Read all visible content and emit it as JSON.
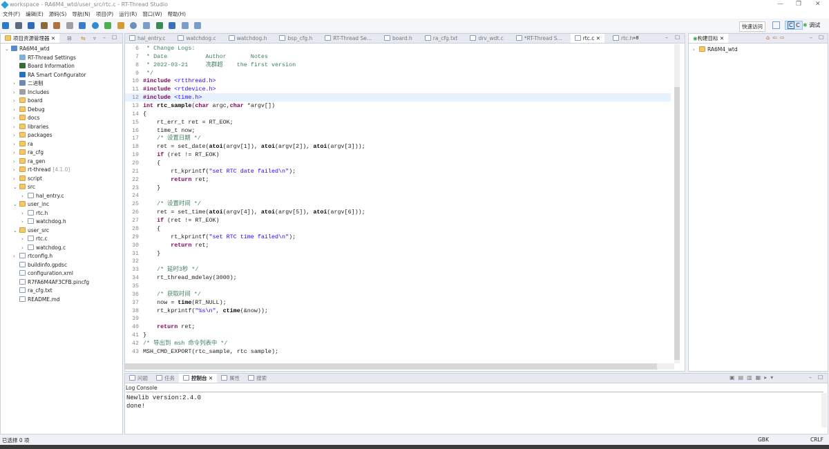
{
  "window": {
    "title": "workspace - RA6M4_wtd/user_src/rtc.c - RT-Thread Studio"
  },
  "menu": [
    "文件(F)",
    "编辑(E)",
    "源码(S)",
    "导航(N)",
    "项目(P)",
    "运行(R)",
    "窗口(W)",
    "帮助(H)"
  ],
  "toolbar": {
    "quick_access": "快速访问",
    "perspective_c": "C",
    "perspective_debug": "调试"
  },
  "explorer": {
    "tab": "项目资源管理器",
    "items": [
      {
        "label": "RA6M4_wtd",
        "level": 0,
        "chev": "v",
        "icon": "project"
      },
      {
        "label": "RT-Thread Settings",
        "level": 1,
        "chev": "",
        "icon": "settings"
      },
      {
        "label": "Board Information",
        "level": 1,
        "chev": "",
        "icon": "board"
      },
      {
        "label": "RA Smart Configurator",
        "level": 1,
        "chev": "",
        "icon": "config"
      },
      {
        "label": "二进制",
        "level": 1,
        "chev": ">",
        "icon": "binary"
      },
      {
        "label": "Includes",
        "level": 1,
        "chev": ">",
        "icon": "includes"
      },
      {
        "label": "board",
        "level": 1,
        "chev": ">",
        "icon": "folder"
      },
      {
        "label": "Debug",
        "level": 1,
        "chev": ">",
        "icon": "folder"
      },
      {
        "label": "docs",
        "level": 1,
        "chev": ">",
        "icon": "folder"
      },
      {
        "label": "libraries",
        "level": 1,
        "chev": ">",
        "icon": "folder"
      },
      {
        "label": "packages",
        "level": 1,
        "chev": ">",
        "icon": "folder"
      },
      {
        "label": "ra",
        "level": 1,
        "chev": ">",
        "icon": "folder"
      },
      {
        "label": "ra_cfg",
        "level": 1,
        "chev": ">",
        "icon": "folder"
      },
      {
        "label": "ra_gen",
        "level": 1,
        "chev": ">",
        "icon": "folder"
      },
      {
        "label": "rt-thread",
        "suffix": "[4.1.0]",
        "level": 1,
        "chev": ">",
        "icon": "folder"
      },
      {
        "label": "script",
        "level": 1,
        "chev": ">",
        "icon": "folder"
      },
      {
        "label": "src",
        "level": 1,
        "chev": "v",
        "icon": "folder"
      },
      {
        "label": "hal_entry.c",
        "level": 2,
        "chev": ">",
        "icon": "file"
      },
      {
        "label": "user_inc",
        "level": 1,
        "chev": "v",
        "icon": "folder"
      },
      {
        "label": "rtc.h",
        "level": 2,
        "chev": ">",
        "icon": "file"
      },
      {
        "label": "watchdog.h",
        "level": 2,
        "chev": ">",
        "icon": "file"
      },
      {
        "label": "user_src",
        "level": 1,
        "chev": "v",
        "icon": "folder"
      },
      {
        "label": "rtc.c",
        "level": 2,
        "chev": ">",
        "icon": "file"
      },
      {
        "label": "watchdog.c",
        "level": 2,
        "chev": ">",
        "icon": "file"
      },
      {
        "label": "rtconfig.h",
        "level": 1,
        "chev": ">",
        "icon": "file"
      },
      {
        "label": "buildinfo.gpdsc",
        "level": 1,
        "chev": "",
        "icon": "file"
      },
      {
        "label": "configuration.xml",
        "level": 1,
        "chev": "",
        "icon": "file"
      },
      {
        "label": "R7FA6M4AF3CFB.pincfg",
        "level": 1,
        "chev": "",
        "icon": "file"
      },
      {
        "label": "ra_cfg.txt",
        "level": 1,
        "chev": "",
        "icon": "file"
      },
      {
        "label": "README.md",
        "level": 1,
        "chev": "",
        "icon": "file"
      }
    ]
  },
  "editor": {
    "tabs": [
      {
        "label": "hal_entry.c"
      },
      {
        "label": "watchdog.c"
      },
      {
        "label": "watchdog.h"
      },
      {
        "label": "bsp_cfg.h"
      },
      {
        "label": "RT-Thread Se..."
      },
      {
        "label": "board.h"
      },
      {
        "label": "ra_cfg.txt"
      },
      {
        "label": "drv_wdt.c"
      },
      {
        "label": "*RT-Thread S..."
      },
      {
        "label": "rtc.c",
        "active": true
      },
      {
        "label": "rtc.h"
      }
    ],
    "overflow": "»8",
    "highlight_line": 12,
    "lines": [
      {
        "n": "6",
        "t": [
          [
            "cm",
            " * Change Logs:"
          ]
        ]
      },
      {
        "n": "7",
        "t": [
          [
            "cm",
            " * Date           Author       Notes"
          ]
        ]
      },
      {
        "n": "8",
        "t": [
          [
            "cm",
            " * 2022-03-21     冼群超    the first version"
          ]
        ]
      },
      {
        "n": "9",
        "t": [
          [
            "cm",
            " */"
          ]
        ]
      },
      {
        "n": "10",
        "t": [
          [
            "pp",
            "#include"
          ],
          [
            "st",
            " <rtthread.h>"
          ]
        ]
      },
      {
        "n": "11",
        "t": [
          [
            "pp",
            "#include"
          ],
          [
            "st",
            " <rtdevice.h>"
          ]
        ]
      },
      {
        "n": "12",
        "t": [
          [
            "pp",
            "#include"
          ],
          [
            "st",
            " <time.h>"
          ]
        ]
      },
      {
        "n": "13",
        "t": [
          [
            "kw",
            "int"
          ],
          [
            "fn",
            " rtc_sample"
          ],
          [
            "",
            "("
          ],
          [
            "kw",
            "char"
          ],
          [
            "",
            " argc,"
          ],
          [
            "kw",
            "char"
          ],
          [
            "",
            " *argv[])"
          ]
        ]
      },
      {
        "n": "14",
        "t": [
          [
            "",
            "{"
          ]
        ]
      },
      {
        "n": "15",
        "t": [
          [
            "",
            "    rt_err_t ret = RT_EOK;"
          ]
        ]
      },
      {
        "n": "16",
        "t": [
          [
            "",
            "    time_t now;"
          ]
        ]
      },
      {
        "n": "17",
        "t": [
          [
            "cm",
            "    /* 设置日期 */"
          ]
        ]
      },
      {
        "n": "18",
        "t": [
          [
            "",
            "    ret = set_date("
          ],
          [
            "fn",
            "atoi"
          ],
          [
            "",
            "(argv[1]), "
          ],
          [
            "fn",
            "atoi"
          ],
          [
            "",
            "(argv[2]), "
          ],
          [
            "fn",
            "atoi"
          ],
          [
            "",
            "(argv[3]));"
          ]
        ]
      },
      {
        "n": "19",
        "t": [
          [
            "kw",
            "    if"
          ],
          [
            "",
            " (ret != RT_EOK)"
          ]
        ]
      },
      {
        "n": "20",
        "t": [
          [
            "",
            "    {"
          ]
        ]
      },
      {
        "n": "21",
        "t": [
          [
            "",
            "        rt_kprintf("
          ],
          [
            "st",
            "\"set RTC date failed\\n\""
          ],
          [
            "",
            ");"
          ]
        ]
      },
      {
        "n": "22",
        "t": [
          [
            "kw",
            "        return"
          ],
          [
            "",
            " ret;"
          ]
        ]
      },
      {
        "n": "23",
        "t": [
          [
            "",
            "    }"
          ]
        ]
      },
      {
        "n": "24",
        "t": [
          [
            "",
            ""
          ]
        ]
      },
      {
        "n": "25",
        "t": [
          [
            "cm",
            "    /* 设置时间 */"
          ]
        ]
      },
      {
        "n": "26",
        "t": [
          [
            "",
            "    ret = set_time("
          ],
          [
            "fn",
            "atoi"
          ],
          [
            "",
            "(argv[4]), "
          ],
          [
            "fn",
            "atoi"
          ],
          [
            "",
            "(argv[5]), "
          ],
          [
            "fn",
            "atoi"
          ],
          [
            "",
            "(argv[6]));"
          ]
        ]
      },
      {
        "n": "27",
        "t": [
          [
            "kw",
            "    if"
          ],
          [
            "",
            " (ret != RT_EOK)"
          ]
        ]
      },
      {
        "n": "28",
        "t": [
          [
            "",
            "    {"
          ]
        ]
      },
      {
        "n": "29",
        "t": [
          [
            "",
            "        rt_kprintf("
          ],
          [
            "st",
            "\"set RTC time failed\\n\""
          ],
          [
            "",
            ");"
          ]
        ]
      },
      {
        "n": "30",
        "t": [
          [
            "kw",
            "        return"
          ],
          [
            "",
            " ret;"
          ]
        ]
      },
      {
        "n": "31",
        "t": [
          [
            "",
            "    }"
          ]
        ]
      },
      {
        "n": "32",
        "t": [
          [
            "",
            ""
          ]
        ]
      },
      {
        "n": "33",
        "t": [
          [
            "cm",
            "    /* 延时3秒 */"
          ]
        ]
      },
      {
        "n": "34",
        "t": [
          [
            "",
            "    rt_thread_mdelay(3000);"
          ]
        ]
      },
      {
        "n": "35",
        "t": [
          [
            "",
            ""
          ]
        ]
      },
      {
        "n": "36",
        "t": [
          [
            "cm",
            "    /* 获取时间 */"
          ]
        ]
      },
      {
        "n": "37",
        "t": [
          [
            "",
            "    now = "
          ],
          [
            "fn",
            "time"
          ],
          [
            "",
            "(RT_NULL);"
          ]
        ]
      },
      {
        "n": "38",
        "t": [
          [
            "",
            "    rt_kprintf("
          ],
          [
            "st",
            "\"%s\\n\""
          ],
          [
            "",
            ", "
          ],
          [
            "fn",
            "ctime"
          ],
          [
            "",
            "(&now));"
          ]
        ]
      },
      {
        "n": "39",
        "t": [
          [
            "",
            ""
          ]
        ]
      },
      {
        "n": "40",
        "t": [
          [
            "kw",
            "    return"
          ],
          [
            "",
            " ret;"
          ]
        ]
      },
      {
        "n": "41",
        "t": [
          [
            "",
            "}"
          ]
        ]
      },
      {
        "n": "42",
        "t": [
          [
            "cm",
            "/* 导出到 msh 命令列表中 */"
          ]
        ]
      },
      {
        "n": "43",
        "t": [
          [
            "",
            "MSH_CMD_EXPORT(rtc_sample, rtc sample);"
          ]
        ]
      }
    ]
  },
  "outline": {
    "tab": "构建目标",
    "root": "RA6M4_wtd"
  },
  "bottom": {
    "tabs": [
      {
        "label": "问题"
      },
      {
        "label": "任务"
      },
      {
        "label": "控制台",
        "active": true
      },
      {
        "label": "属性"
      },
      {
        "label": "搜索"
      }
    ],
    "console_title": "Log Console",
    "output": [
      "Newlib version:2.4.0",
      "done!"
    ]
  },
  "status": {
    "selection": "已选择 0 项",
    "encoding": "GBK",
    "line_ending": "CRLF"
  }
}
